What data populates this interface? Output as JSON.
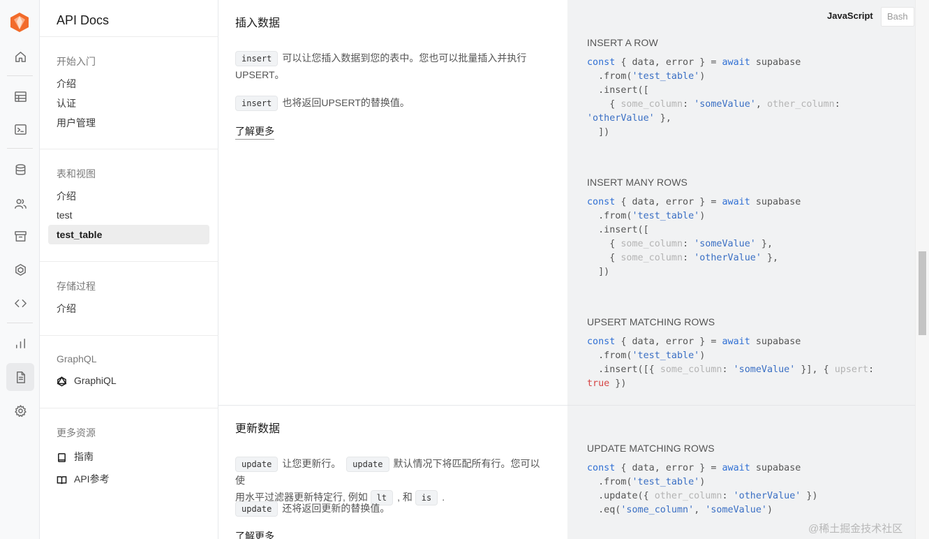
{
  "app": {
    "title": "API Docs"
  },
  "sidebar": {
    "groups": [
      {
        "label": "开始入门",
        "items": [
          "介绍",
          "认证",
          "用户管理"
        ]
      },
      {
        "label": "表和视图",
        "items": [
          "介绍",
          "test",
          "test_table"
        ]
      },
      {
        "label": "存储过程",
        "items": [
          "介绍"
        ]
      },
      {
        "label": "GraphQL",
        "items": [
          "GraphiQL"
        ]
      },
      {
        "label": "更多资源",
        "items": [
          "指南",
          "API参考"
        ]
      }
    ]
  },
  "insert_section": {
    "heading": "插入数据",
    "p1_tag": "insert",
    "p1_text": "可以让您插入数据到您的表中。您也可以批量插入并执行",
    "p1_text2": "UPSERT。",
    "p2_tag": "insert",
    "p2_text": "也将返回UPSERT的替换值。",
    "learn_more": "了解更多"
  },
  "update_section": {
    "heading": "更新数据",
    "tag_update": "update",
    "p1_a": "让您更新行。",
    "p1_b": "默认情况下将匹配所有行。您可以使",
    "p1_c": "用水平过滤器更新特定行, 例如",
    "tag_lt": "lt",
    "p1_d": ", 和",
    "tag_is": "is",
    "p1_e": ".",
    "p2_text": "还将返回更新的替换值。",
    "learn_more": "了解更多"
  },
  "code_panel": {
    "lang_active": "JavaScript",
    "lang_other": "Bash",
    "sections": [
      "INSERT A ROW",
      "INSERT MANY ROWS",
      "UPSERT MATCHING ROWS",
      "UPDATE MATCHING ROWS"
    ]
  },
  "watermark": "@稀土掘金技术社区",
  "colors": {
    "keyword": "#2f6fd4",
    "dim": "#b4b4b4",
    "bool": "#d64545",
    "logo": "#f97b3a"
  }
}
